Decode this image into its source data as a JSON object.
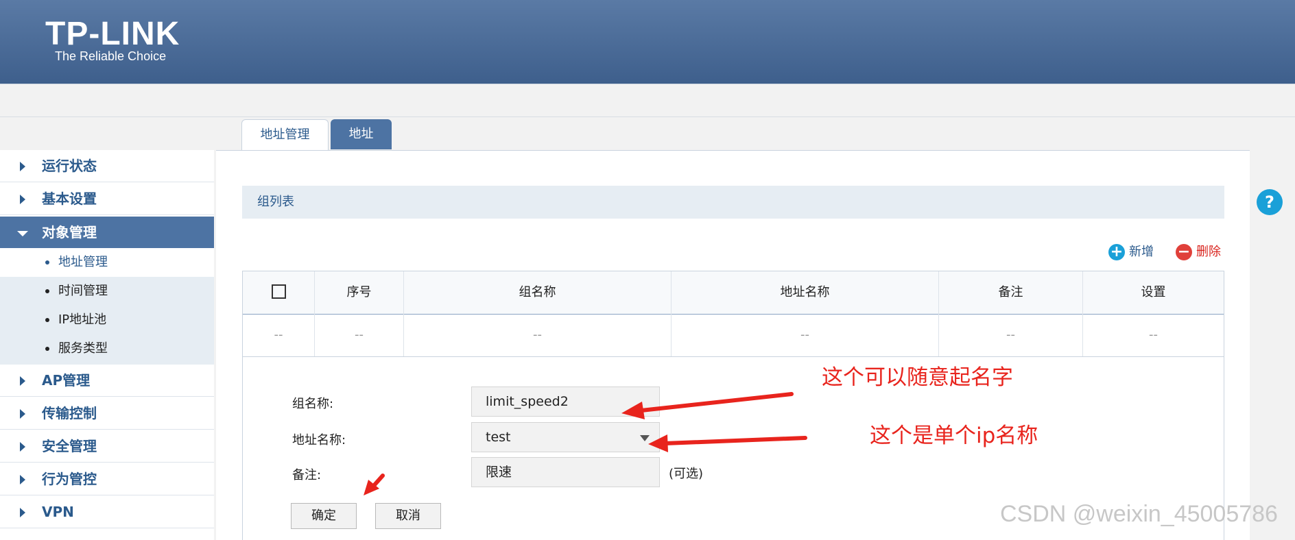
{
  "brand": {
    "logo_text": "TP-LINK",
    "tagline": "The Reliable Choice"
  },
  "tabs": [
    {
      "label": "地址管理"
    },
    {
      "label": "地址"
    }
  ],
  "sidebar": {
    "items": [
      {
        "label": "运行状态"
      },
      {
        "label": "基本设置"
      },
      {
        "label": "对象管理"
      },
      {
        "label": "AP管理"
      },
      {
        "label": "传输控制"
      },
      {
        "label": "安全管理"
      },
      {
        "label": "行为管控"
      },
      {
        "label": "VPN"
      }
    ],
    "subitems": [
      {
        "label": "地址管理"
      },
      {
        "label": "时间管理"
      },
      {
        "label": "IP地址池"
      },
      {
        "label": "服务类型"
      }
    ]
  },
  "section_title": "组列表",
  "actions": {
    "add_label": "新增",
    "delete_label": "删除"
  },
  "table": {
    "columns": [
      "",
      "序号",
      "组名称",
      "地址名称",
      "备注",
      "设置"
    ],
    "placeholder_row": [
      "--",
      "--",
      "--",
      "--",
      "--",
      "--"
    ]
  },
  "form": {
    "group_name_label": "组名称:",
    "group_name_value": "limit_speed2",
    "address_name_label": "地址名称:",
    "address_name_value": "test",
    "remark_label": "备注:",
    "remark_value": "限速",
    "optional_hint": "(可选)",
    "ok_label": "确定",
    "cancel_label": "取消"
  },
  "annotations": {
    "note1": "这个可以随意起名字",
    "note2": "这个是单个ip名称"
  },
  "help_glyph": "?",
  "watermark": "CSDN @weixin_45005786",
  "colors": {
    "header_blue": "#3e5f8c",
    "accent_blue": "#4d73a3",
    "annotation_red": "#e8241d",
    "help_blue": "#1aa0d8"
  }
}
